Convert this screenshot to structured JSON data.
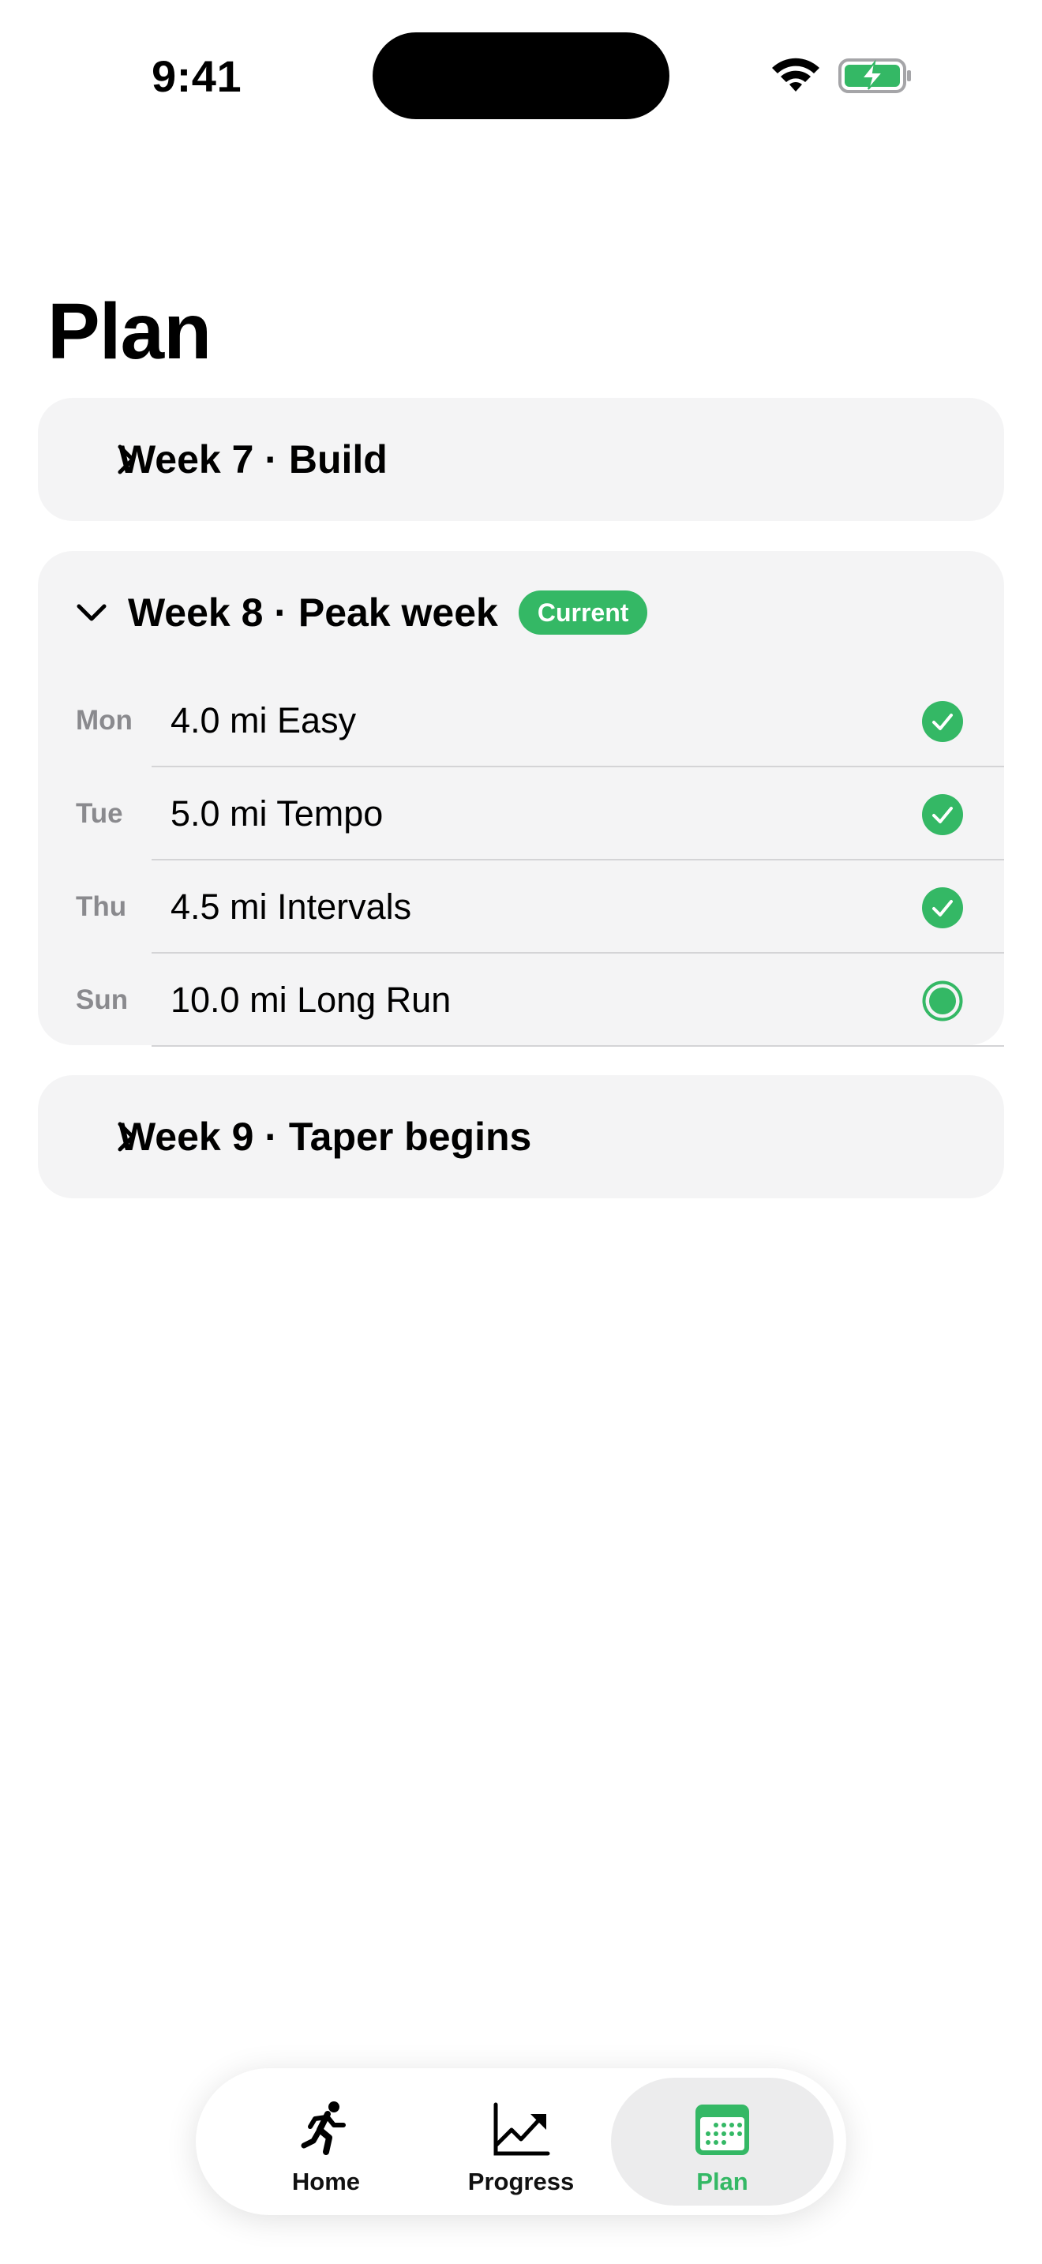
{
  "status_bar": {
    "time": "9:41"
  },
  "page_title": "Plan",
  "weeks": [
    {
      "title": "Week 7 · Build",
      "expanded": false
    },
    {
      "title": "Week 8 · Peak week",
      "badge": "Current",
      "expanded": true,
      "workouts": [
        {
          "day": "Mon",
          "label": "4.0 mi Easy",
          "status": "completed"
        },
        {
          "day": "Tue",
          "label": "5.0 mi Tempo",
          "status": "completed"
        },
        {
          "day": "Thu",
          "label": "4.5 mi Intervals",
          "status": "completed"
        },
        {
          "day": "Sun",
          "label": "10.0 mi Long Run",
          "status": "scheduled"
        }
      ]
    },
    {
      "title": "Week 9 · Taper begins",
      "expanded": false
    }
  ],
  "tabs": [
    {
      "label": "Home",
      "icon": "runner-icon",
      "selected": false
    },
    {
      "label": "Progress",
      "icon": "trend-chart-icon",
      "selected": false
    },
    {
      "label": "Plan",
      "icon": "calendar-icon",
      "selected": true
    }
  ],
  "colors": {
    "accent": "#34b865",
    "card_bg": "#f4f4f5",
    "secondary_text": "#8a8a8e"
  }
}
